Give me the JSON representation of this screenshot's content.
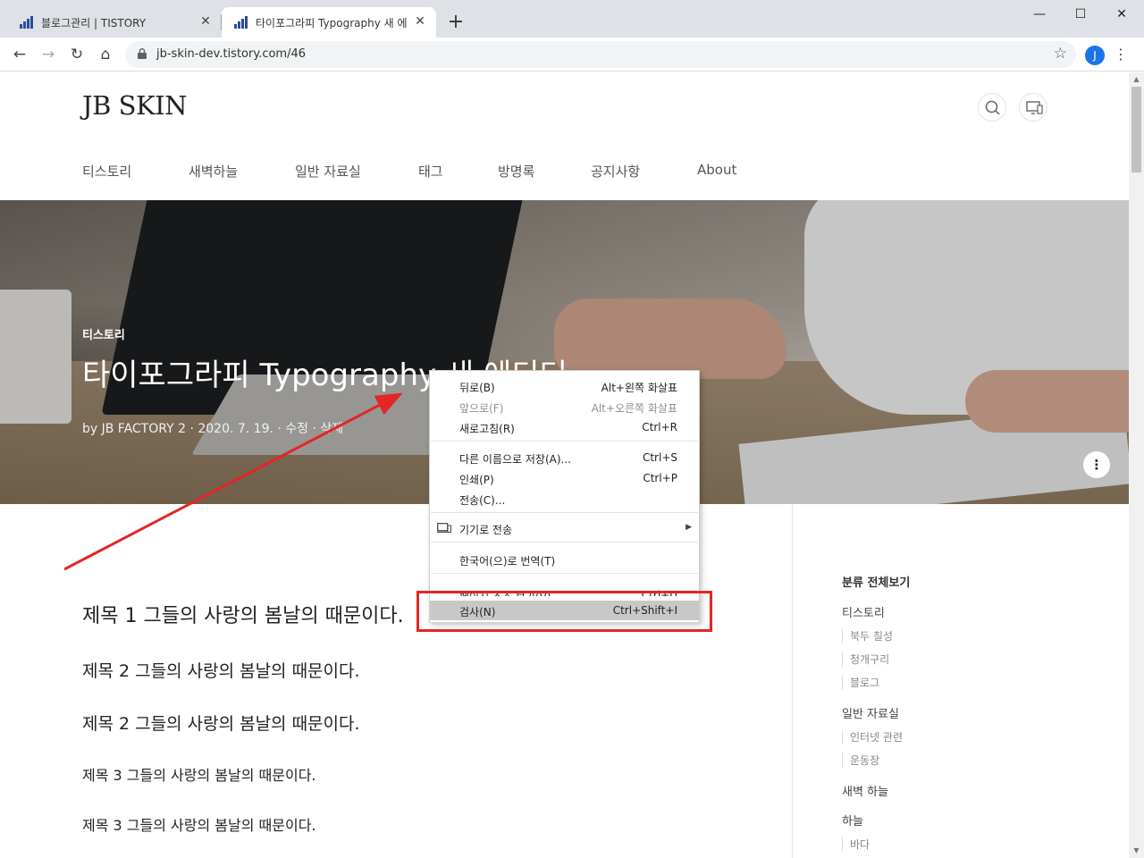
{
  "browser": {
    "tabs": [
      {
        "title": "블로그관리 | TISTORY"
      },
      {
        "title": "타이포그라피 Typography 새 에"
      }
    ],
    "new_tab": "+",
    "url": "jb-skin-dev.tistory.com/46",
    "profile_initial": "J",
    "window_controls": {
      "minimize": "—",
      "maximize": "☐",
      "close": "✕"
    },
    "nav": {
      "back": "←",
      "forward": "→",
      "reload": "↻",
      "home": "⌂",
      "star": "☆",
      "menu": "⋮"
    }
  },
  "site": {
    "logo": "JB SKIN",
    "nav": [
      "티스토리",
      "새벽하늘",
      "일반 자료실",
      "태그",
      "방명록",
      "공지사항",
      "About"
    ]
  },
  "post": {
    "category": "티스토리",
    "title": "타이포그라피 Typography 새 에디터",
    "meta": "by JB FACTORY 2  ·  2020. 7. 19.  ·  수정  ·  삭제",
    "share": "⋮"
  },
  "content": {
    "headings": [
      "제목 1 그들의 사랑의 봄날의 때문이다.",
      "제목 2 그들의 사랑의 봄날의 때문이다.",
      "제목 2 그들의 사랑의 봄날의 때문이다.",
      "제목 3 그들의 사랑의 봄날의 때문이다.",
      "제목 3 그들의 사랑의 봄날의 때문이다."
    ]
  },
  "sidebar": {
    "title": "분류 전체보기",
    "categories": [
      {
        "name": "티스토리",
        "subs": [
          "북두 칠성",
          "청개구리",
          "블로그"
        ]
      },
      {
        "name": "일반 자료실",
        "subs": [
          "인터넷 관련",
          "운동장"
        ]
      },
      {
        "name": "새벽 하늘",
        "subs": []
      },
      {
        "name": "하늘",
        "subs": [
          "바다"
        ]
      }
    ]
  },
  "context_menu": {
    "items": [
      {
        "label": "뒤로(B)",
        "shortcut": "Alt+왼쪽 화살표",
        "disabled": false
      },
      {
        "label": "앞으로(F)",
        "shortcut": "Alt+오른쪽 화살표",
        "disabled": true
      },
      {
        "label": "새로고침(R)",
        "shortcut": "Ctrl+R",
        "disabled": false
      },
      {
        "label": "다른 이름으로 저장(A)...",
        "shortcut": "Ctrl+S",
        "disabled": false
      },
      {
        "label": "인쇄(P)",
        "shortcut": "Ctrl+P",
        "disabled": false
      },
      {
        "label": "전송(C)...",
        "shortcut": "",
        "disabled": false
      },
      {
        "label": "기기로 전송",
        "shortcut": "",
        "disabled": false,
        "icon": "cast-device-icon",
        "submenu": true
      },
      {
        "label": "한국어(으)로 번역(T)",
        "shortcut": "",
        "disabled": false
      },
      {
        "label": "페이지 소스 보기(V)",
        "shortcut": "Ctrl+U",
        "disabled": false
      },
      {
        "label": "검사(N)",
        "shortcut": "Ctrl+Shift+I",
        "disabled": false,
        "highlighted": true
      }
    ]
  },
  "annotation": {
    "color": "#e32626"
  }
}
